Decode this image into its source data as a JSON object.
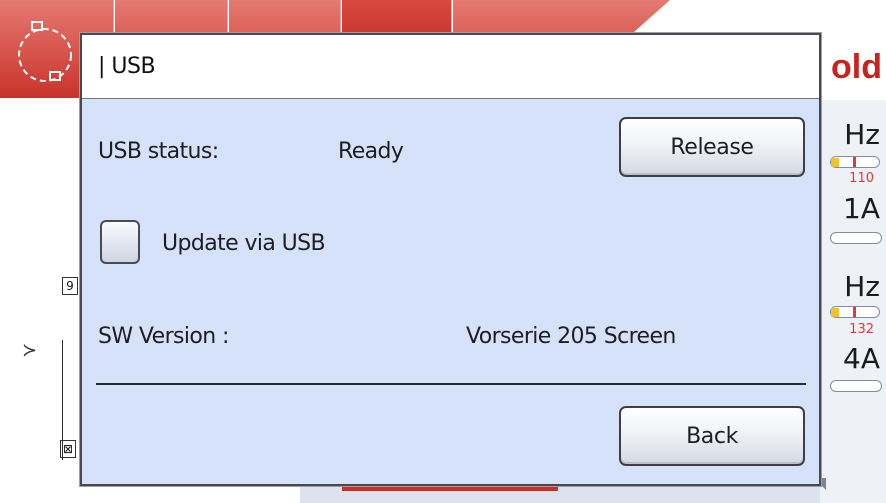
{
  "background_app": {
    "brand_fragment": "old",
    "meters": [
      {
        "unit": "Hz",
        "value_label": "110",
        "amp_label": "1A"
      },
      {
        "unit": "Hz",
        "value_label": "132",
        "amp_label": "4A"
      }
    ],
    "diagram_boxes": [
      "9",
      "⊠"
    ]
  },
  "dialog": {
    "title": "| USB",
    "usb_status_label": "USB status:",
    "usb_status_value": "Ready",
    "release_button": "Release",
    "update_checkbox_label": "Update via USB",
    "update_checked": false,
    "sw_version_label": "SW Version :",
    "sw_version_value": "Vorserie 205 Screen",
    "back_button": "Back"
  },
  "colors": {
    "dialog_bg": "#d6e2f9",
    "toolbar_red": "#c9332c",
    "brand_red": "#c8231d",
    "meter_red": "#e53935"
  }
}
